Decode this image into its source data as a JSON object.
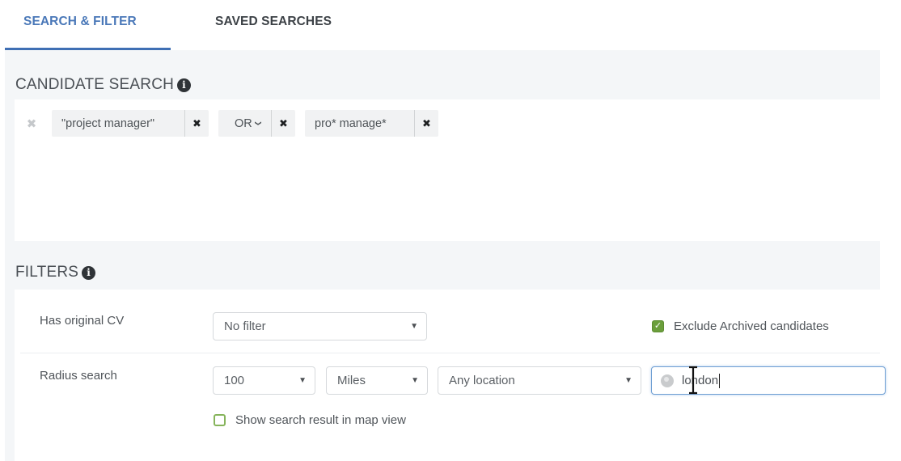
{
  "tabs": [
    {
      "label": "SEARCH & FILTER",
      "active": true
    },
    {
      "label": "SAVED SEARCHES",
      "active": false
    }
  ],
  "candidate_search": {
    "title": "CANDIDATE SEARCH",
    "info_icon": "info-circle-icon",
    "clear_icon": "clear-all-x-icon",
    "terms": [
      {
        "type": "term",
        "text": "\"project manager\"",
        "remove_icon": "x-icon"
      },
      {
        "type": "operator",
        "text": "OR",
        "dropdown_icon": "chevron-down-icon",
        "remove_icon": "x-icon"
      },
      {
        "type": "term",
        "text": "pro* manage*",
        "remove_icon": "x-icon"
      }
    ]
  },
  "filters": {
    "title": "FILTERS",
    "info_icon": "info-circle-icon",
    "has_original_cv": {
      "label": "Has original CV",
      "value": "No filter"
    },
    "exclude_archived": {
      "label": "Exclude Archived candidates",
      "checked": true
    },
    "radius_search": {
      "label": "Radius search",
      "distance": "100",
      "unit": "Miles",
      "location_type": "Any location",
      "location_input_value": "london",
      "location_icon": "globe-icon"
    },
    "show_map_view": {
      "label": "Show search result in map view",
      "checked": false
    }
  },
  "colors": {
    "accent": "#3f6fb4",
    "checkbox_green": "#6b9e3c",
    "panel_bg": "#f4f6f8",
    "input_focus": "#6f9fd3"
  }
}
